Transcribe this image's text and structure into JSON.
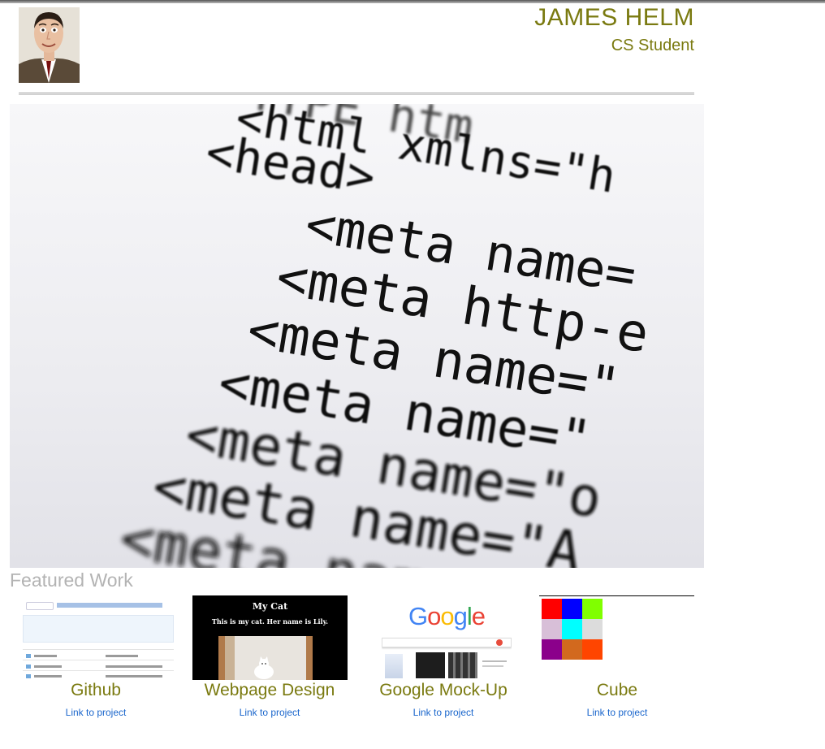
{
  "header": {
    "name": "JAMES HELM",
    "subtitle": "CS Student"
  },
  "featured": {
    "heading": "Featured Work",
    "projects": [
      {
        "title": "Github",
        "link": "Link to project"
      },
      {
        "title": "Webpage Design",
        "link": "Link to project"
      },
      {
        "title": "Google Mock-Up",
        "link": "Link to project"
      },
      {
        "title": "Cube",
        "link": "Link to project"
      }
    ]
  },
  "webpage_thumb": {
    "title": "My Cat",
    "text": "This is my cat. Her name is Lily."
  },
  "google_thumb": {
    "logo": "Google"
  },
  "cube_thumb": {
    "colors": [
      "#ff0000",
      "#0000ff",
      "#80ff00",
      "#d8bfd8",
      "#00ffff",
      "#dcdcdc",
      "#8b008b",
      "#d2691e",
      "#ff4500"
    ]
  },
  "colors": {
    "accent": "#7a7a10",
    "link": "#1a66cc",
    "heading_muted": "#b3b3b3"
  }
}
